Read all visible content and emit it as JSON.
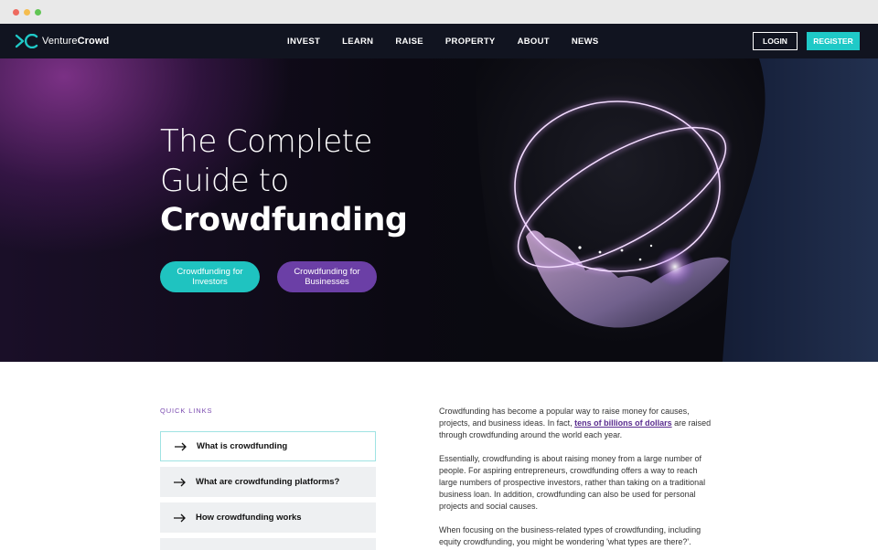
{
  "brand": {
    "name_light": "Venture",
    "name_bold": "Crowd"
  },
  "nav": {
    "links": [
      "INVEST",
      "LEARN",
      "RAISE",
      "PROPERTY",
      "ABOUT",
      "NEWS"
    ],
    "login": "LOGIN",
    "register": "REGISTER"
  },
  "hero": {
    "title_line1": "The Complete",
    "title_line2": "Guide to",
    "title_line3": "Crowdfunding",
    "btn_investors_1": "Crowdfunding for",
    "btn_investors_2": "Investors",
    "btn_business_1": "Crowdfunding for",
    "btn_business_2": "Businesses"
  },
  "quick_links": {
    "label": "QUICK LINKS",
    "items": [
      "What is crowdfunding",
      "What are crowdfunding platforms?",
      "How crowdfunding works",
      ""
    ]
  },
  "content": {
    "p1_a": "Crowdfunding has become a popular way to raise money for causes, projects, and business ideas. In fact,",
    "p1_link": "tens of billions of dollars",
    "p1_b": "are raised through crowdfunding around the world each year.",
    "p2": "Essentially, crowdfunding is about raising money from a large number of people. For aspiring entrepreneurs, crowdfunding offers a way to reach large numbers of prospective investors, rather than taking on a traditional business loan. In addition, crowdfunding can also be used for personal projects and social causes.",
    "p3": "When focusing on the business-related types of crowdfunding, including equity crowdfunding, you might be wondering 'what types are there?'."
  },
  "colors": {
    "nav_bg": "#111420",
    "accent_teal": "#1fc3c0",
    "accent_purple": "#6b3fa6",
    "link_purple": "#5a2d8f"
  }
}
